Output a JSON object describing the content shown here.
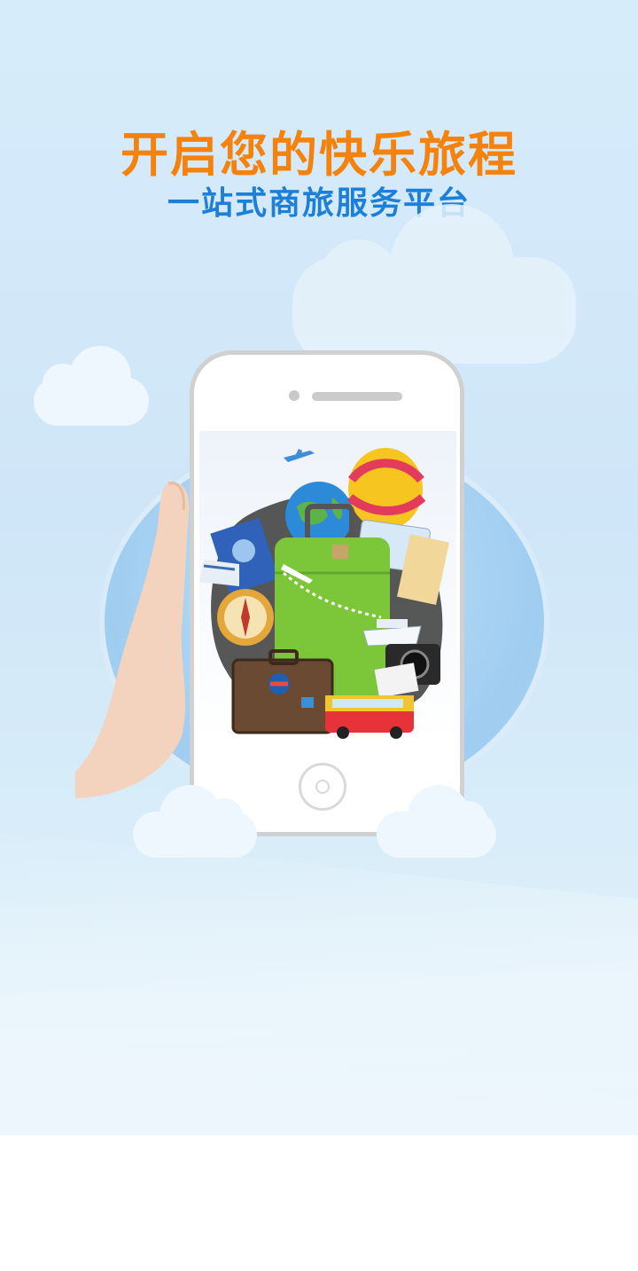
{
  "headline": {
    "title": "开启您的快乐旅程",
    "subtitle": "一站式商旅服务平台"
  },
  "colors": {
    "title": "#f5820c",
    "subtitle": "#1c7fd8",
    "background": "#d7ecfb",
    "suitcase": "#7cc63a"
  },
  "illustration": {
    "icons": [
      "airplane-icon",
      "hot-air-balloon-icon",
      "globe-icon",
      "passport-icon",
      "credit-card-icon",
      "compass-icon",
      "suitcase-icon",
      "luggage-icon",
      "camera-icon",
      "ship-icon",
      "bus-icon",
      "train-icon"
    ]
  }
}
